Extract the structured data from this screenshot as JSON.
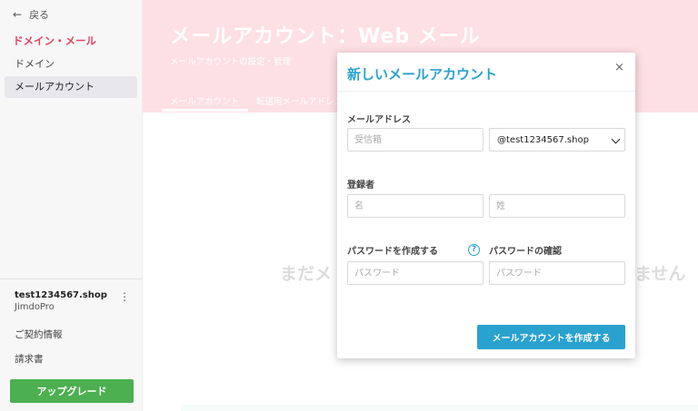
{
  "sidebar": {
    "back_label": "戻る",
    "back_icon": "arrow-left-icon",
    "section_title": "ドメイン・メール",
    "items": [
      {
        "label": "ドメイン",
        "active": false
      },
      {
        "label": "メールアカウント",
        "active": true
      }
    ],
    "domain_name": "test1234567.shop",
    "plan": "JimdoPro",
    "links": [
      "ご契約情報",
      "請求書"
    ],
    "upgrade_label": "アップグレード"
  },
  "main": {
    "title": "メールアカウント：Web メール",
    "subtitle": "メールアカウントの設定・管理",
    "tabs": [
      "メールアカウント",
      "転送用メールアドレス"
    ],
    "empty_left": "まだメ",
    "empty_right": "ません"
  },
  "modal": {
    "title": "新しいメールアカウント",
    "close": "×",
    "email_label": "メールアドレス",
    "inbox_placeholder": "受信箱",
    "domain_value": "@test1234567.shop",
    "owner_label": "登録者",
    "first_placeholder": "名",
    "last_placeholder": "姓",
    "password_label": "パスワードを作成する",
    "password_help": "?",
    "password_confirm_label": "パスワードの確認",
    "password_placeholder": "パスワード",
    "password_confirm_placeholder": "パスワード",
    "create_label": "メールアカウントを作成する"
  },
  "colors": {
    "accent": "#29a2cf",
    "brand_red": "#e0455f",
    "hero_bg": "#fde0e4",
    "upgrade": "#4caf50"
  }
}
